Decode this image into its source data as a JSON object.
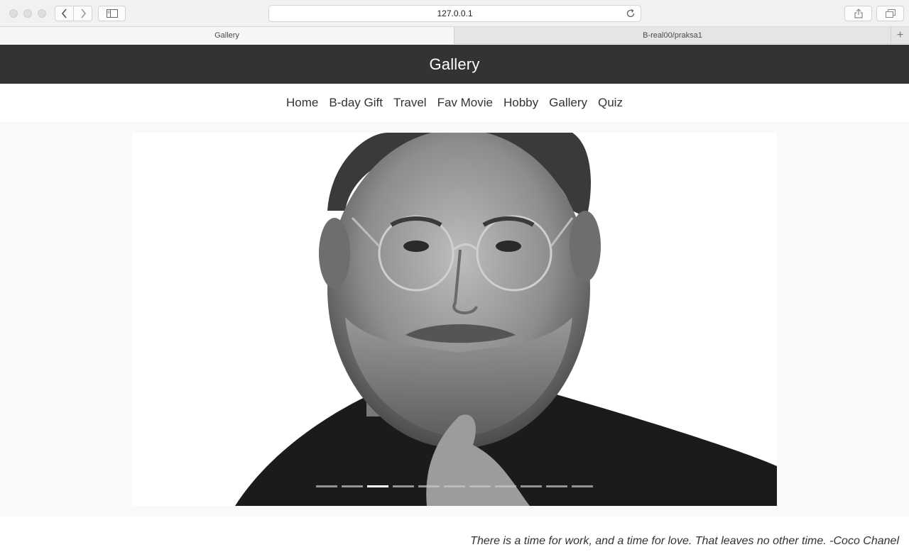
{
  "browser": {
    "url": "127.0.0.1",
    "tabs": [
      {
        "label": "Gallery",
        "active": true
      },
      {
        "label": "B-real00/praksa1",
        "active": false
      }
    ],
    "newtab_icon": "plus-icon"
  },
  "header": {
    "title": "Gallery"
  },
  "nav": {
    "items": [
      "Home",
      "B-day Gift",
      "Travel",
      "Fav Movie",
      "Hobby",
      "Gallery",
      "Quiz"
    ]
  },
  "carousel": {
    "indicator_count": 11,
    "active_index": 2
  },
  "footer": {
    "quote": "There is a time for work, and a time for love. That leaves no other time. -Coco Chanel"
  },
  "colors": {
    "header_bg": "#333333",
    "content_bg": "#f9f9f9"
  }
}
